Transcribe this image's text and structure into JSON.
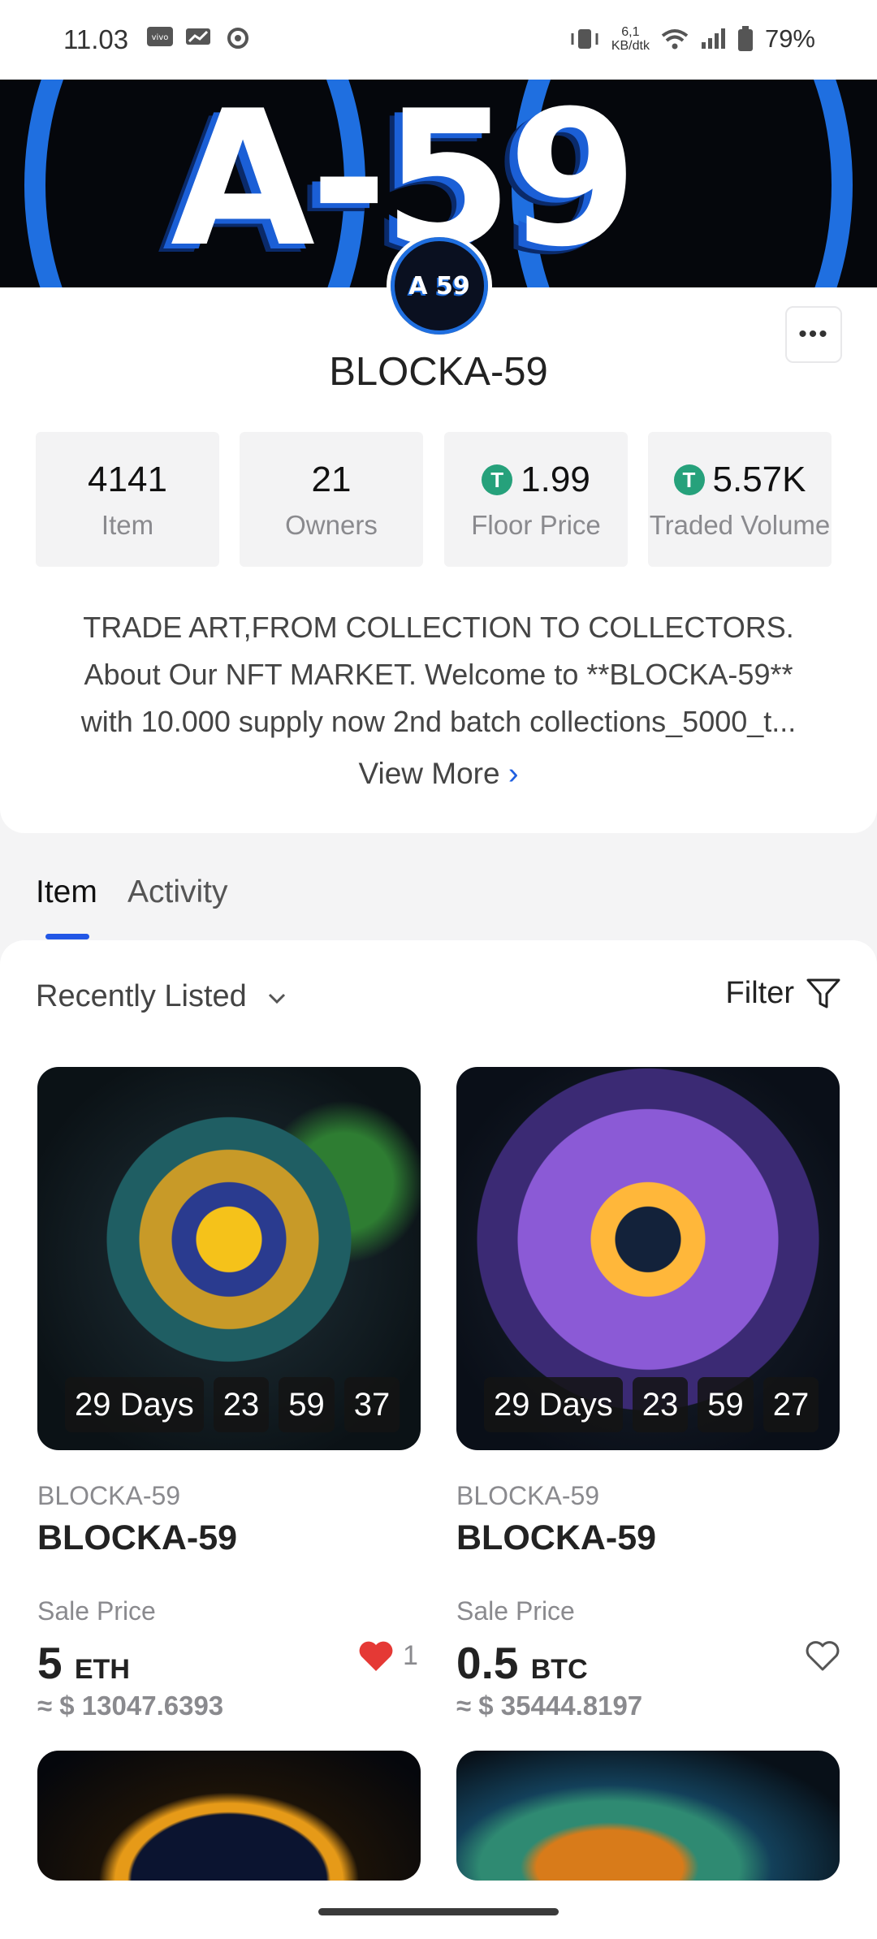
{
  "status_bar": {
    "time": "11.03",
    "net_speed_value": "6,1",
    "net_speed_unit": "KB/dtk",
    "battery": "79%"
  },
  "collection": {
    "banner_text": "A-59",
    "avatar_text": "A 59",
    "name": "BLOCKA-59",
    "stats": [
      {
        "value": "4141",
        "label": "Item",
        "currency_icon": false
      },
      {
        "value": "21",
        "label": "Owners",
        "currency_icon": false
      },
      {
        "value": "1.99",
        "label": "Floor Price",
        "currency_icon": true
      },
      {
        "value": "5.57K",
        "label": "Traded Volume",
        "currency_icon": true
      }
    ],
    "description_lines": [
      "TRADE ART,FROM COLLECTION TO COLLECTORS.",
      "About Our NFT MARKET. Welcome to **BLOCKA-59**",
      "with 10.000 supply now 2nd batch collections_5000_t..."
    ],
    "view_more": "View More"
  },
  "tabs": [
    {
      "label": "Item",
      "active": true
    },
    {
      "label": "Activity",
      "active": false
    }
  ],
  "toolbar": {
    "sort_label": "Recently Listed",
    "filter_label": "Filter"
  },
  "items": [
    {
      "timer": {
        "days": "29 Days",
        "hours": "23",
        "minutes": "59",
        "seconds": "37"
      },
      "collection": "BLOCKA-59",
      "name": "BLOCKA-59",
      "price_label": "Sale Price",
      "price": "5",
      "currency": "ETH",
      "usd": "≈ $ 13047.6393",
      "liked": true,
      "like_count": "1"
    },
    {
      "timer": {
        "days": "29 Days",
        "hours": "23",
        "minutes": "59",
        "seconds": "27"
      },
      "collection": "BLOCKA-59",
      "name": "BLOCKA-59",
      "price_label": "Sale Price",
      "price": "0.5",
      "currency": "BTC",
      "usd": "≈ $ 35444.8197",
      "liked": false,
      "like_count": ""
    }
  ],
  "colors": {
    "accent": "#2257e6",
    "tether": "#26a17b",
    "like": "#e53935",
    "banner_blue": "#1f6fe0"
  }
}
